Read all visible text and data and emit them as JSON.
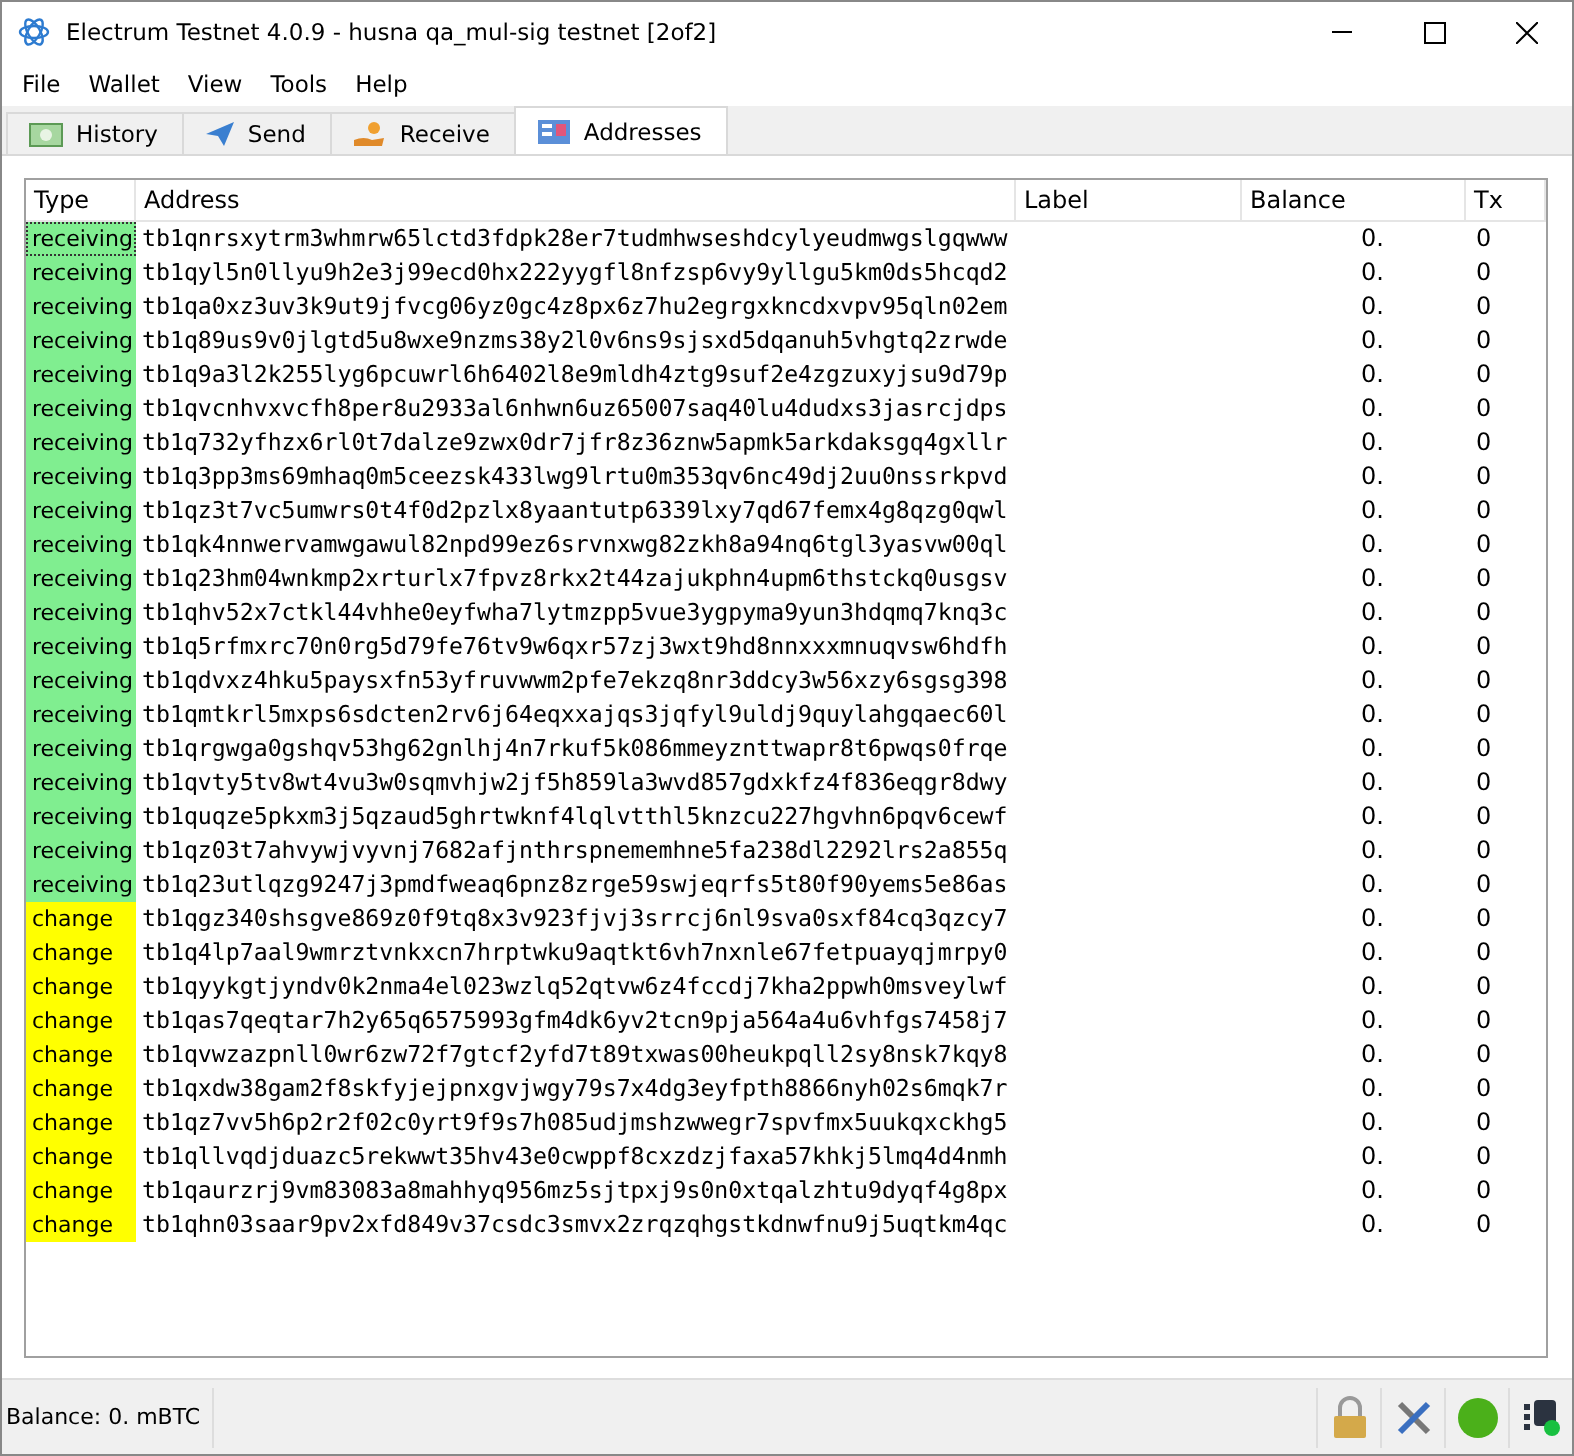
{
  "window": {
    "title": "Electrum Testnet 4.0.9  -  husna qa_mul-sig testnet  [2of2]"
  },
  "menu": [
    "File",
    "Wallet",
    "View",
    "Tools",
    "Help"
  ],
  "tabs": [
    {
      "label": "History",
      "selected": false
    },
    {
      "label": "Send",
      "selected": false
    },
    {
      "label": "Receive",
      "selected": false
    },
    {
      "label": "Addresses",
      "selected": true
    }
  ],
  "table": {
    "columns": [
      "Type",
      "Address",
      "Label",
      "Balance",
      "Tx"
    ],
    "rows": [
      {
        "type": "receiving",
        "kind": "receiving",
        "focused": true,
        "address": "tb1qnrsxytrm3whmrw65lctd3fdpk28er7tudmhwseshdcylyeudmwgslgqwww",
        "balance": "0.",
        "tx": "0"
      },
      {
        "type": "receiving",
        "kind": "receiving",
        "focused": false,
        "address": "tb1qyl5n0llyu9h2e3j99ecd0hx222yygfl8nfzsp6vy9yllgu5km0ds5hcqd2",
        "balance": "0.",
        "tx": "0"
      },
      {
        "type": "receiving",
        "kind": "receiving",
        "focused": false,
        "address": "tb1qa0xz3uv3k9ut9jfvcg06yz0gc4z8px6z7hu2egrgxkncdxvpv95qln02em",
        "balance": "0.",
        "tx": "0"
      },
      {
        "type": "receiving",
        "kind": "receiving",
        "focused": false,
        "address": "tb1q89us9v0jlgtd5u8wxe9nzms38y2l0v6ns9sjsxd5dqanuh5vhgtq2zrwde",
        "balance": "0.",
        "tx": "0"
      },
      {
        "type": "receiving",
        "kind": "receiving",
        "focused": false,
        "address": "tb1q9a3l2k255lyg6pcuwrl6h6402l8e9mldh4ztg9suf2e4zgzuxyjsu9d79p",
        "balance": "0.",
        "tx": "0"
      },
      {
        "type": "receiving",
        "kind": "receiving",
        "focused": false,
        "address": "tb1qvcnhvxvcfh8per8u2933al6nhwn6uz65007saq40lu4dudxs3jasrcjdps",
        "balance": "0.",
        "tx": "0"
      },
      {
        "type": "receiving",
        "kind": "receiving",
        "focused": false,
        "address": "tb1q732yfhzx6rl0t7dalze9zwx0dr7jfr8z36znw5apmk5arkdaksgq4gxllr",
        "balance": "0.",
        "tx": "0"
      },
      {
        "type": "receiving",
        "kind": "receiving",
        "focused": false,
        "address": "tb1q3pp3ms69mhaq0m5ceezsk433lwg9lrtu0m353qv6nc49dj2uu0nssrkpvd",
        "balance": "0.",
        "tx": "0"
      },
      {
        "type": "receiving",
        "kind": "receiving",
        "focused": false,
        "address": "tb1qz3t7vc5umwrs0t4f0d2pzlx8yaantutp6339lxy7qd67femx4g8qzg0qwl",
        "balance": "0.",
        "tx": "0"
      },
      {
        "type": "receiving",
        "kind": "receiving",
        "focused": false,
        "address": "tb1qk4nnwervamwgawul82npd99ez6srvnxwg82zkh8a94nq6tgl3yasvw00ql",
        "balance": "0.",
        "tx": "0"
      },
      {
        "type": "receiving",
        "kind": "receiving",
        "focused": false,
        "address": "tb1q23hm04wnkmp2xrturlx7fpvz8rkx2t44zajukphn4upm6thstckq0usgsv",
        "balance": "0.",
        "tx": "0"
      },
      {
        "type": "receiving",
        "kind": "receiving",
        "focused": false,
        "address": "tb1qhv52x7ctkl44vhhe0eyfwha7lytmzpp5vue3ygpyma9yun3hdqmq7knq3c",
        "balance": "0.",
        "tx": "0"
      },
      {
        "type": "receiving",
        "kind": "receiving",
        "focused": false,
        "address": "tb1q5rfmxrc70n0rg5d79fe76tv9w6qxr57zj3wxt9hd8nnxxxmnuqvsw6hdfh",
        "balance": "0.",
        "tx": "0"
      },
      {
        "type": "receiving",
        "kind": "receiving",
        "focused": false,
        "address": "tb1qdvxz4hku5paysxfn53yfruvwwm2pfe7ekzq8nr3ddcy3w56xzy6sgsg398",
        "balance": "0.",
        "tx": "0"
      },
      {
        "type": "receiving",
        "kind": "receiving",
        "focused": false,
        "address": "tb1qmtkrl5mxps6sdcten2rv6j64eqxxajqs3jqfyl9uldj9quylahgqaec60l",
        "balance": "0.",
        "tx": "0"
      },
      {
        "type": "receiving",
        "kind": "receiving",
        "focused": false,
        "address": "tb1qrgwga0gshqv53hg62gnlhj4n7rkuf5k086mmeyznttwapr8t6pwqs0frqe",
        "balance": "0.",
        "tx": "0"
      },
      {
        "type": "receiving",
        "kind": "receiving",
        "focused": false,
        "address": "tb1qvty5tv8wt4vu3w0sqmvhjw2jf5h859la3wvd857gdxkfz4f836eqgr8dwy",
        "balance": "0.",
        "tx": "0"
      },
      {
        "type": "receiving",
        "kind": "receiving",
        "focused": false,
        "address": "tb1quqze5pkxm3j5qzaud5ghrtwknf4lqlvtthl5knzcu227hgvhn6pqv6cewf",
        "balance": "0.",
        "tx": "0"
      },
      {
        "type": "receiving",
        "kind": "receiving",
        "focused": false,
        "address": "tb1qz03t7ahvywjvyvnj7682afjnthrspnememhne5fa238dl2292lrs2a855q",
        "balance": "0.",
        "tx": "0"
      },
      {
        "type": "receiving",
        "kind": "receiving",
        "focused": false,
        "address": "tb1q23utlqzg9247j3pmdfweaq6pnz8zrge59swjeqrfs5t80f90yems5e86as",
        "balance": "0.",
        "tx": "0"
      },
      {
        "type": "change",
        "kind": "change",
        "focused": false,
        "address": "tb1qgz340shsgve869z0f9tq8x3v923fjvj3srrcj6nl9sva0sxf84cq3qzcy7",
        "balance": "0.",
        "tx": "0"
      },
      {
        "type": "change",
        "kind": "change",
        "focused": false,
        "address": "tb1q4lp7aal9wmrztvnkxcn7hrptwku9aqtkt6vh7nxnle67fetpuayqjmrpy0",
        "balance": "0.",
        "tx": "0"
      },
      {
        "type": "change",
        "kind": "change",
        "focused": false,
        "address": "tb1qyykgtjyndv0k2nma4el023wzlq52qtvw6z4fccdj7kha2ppwh0msveylwf",
        "balance": "0.",
        "tx": "0"
      },
      {
        "type": "change",
        "kind": "change",
        "focused": false,
        "address": "tb1qas7qeqtar7h2y65q6575993gfm4dk6yv2tcn9pja564a4u6vhfgs7458j7",
        "balance": "0.",
        "tx": "0"
      },
      {
        "type": "change",
        "kind": "change",
        "focused": false,
        "address": "tb1qvwzazpnll0wr6zw72f7gtcf2yfd7t89txwas00heukpqll2sy8nsk7kqy8",
        "balance": "0.",
        "tx": "0"
      },
      {
        "type": "change",
        "kind": "change",
        "focused": false,
        "address": "tb1qxdw38gam2f8skfyjejpnxgvjwgy79s7x4dg3eyfpth8866nyh02s6mqk7r",
        "balance": "0.",
        "tx": "0"
      },
      {
        "type": "change",
        "kind": "change",
        "focused": false,
        "address": "tb1qz7vv5h6p2r2f02c0yrt9f9s7h085udjmshzwwegr7spvfmx5uukqxckhg5",
        "balance": "0.",
        "tx": "0"
      },
      {
        "type": "change",
        "kind": "change",
        "focused": false,
        "address": "tb1qllvqdjduazc5rekwwt35hv43e0cwppf8cxzdzjfaxa57khkj5lmq4d4nmh",
        "balance": "0.",
        "tx": "0"
      },
      {
        "type": "change",
        "kind": "change",
        "focused": false,
        "address": "tb1qaurzrj9vm83083a8mahhyq956mz5sjtpxj9s0n0xtqalzhtu9dyqf4g8px",
        "balance": "0.",
        "tx": "0"
      },
      {
        "type": "change",
        "kind": "change",
        "focused": false,
        "address": "tb1qhn03saar9pv2xfd849v37csdc3smvx2zrqzqhgstkdnwfnu9j5uqtkm4qc",
        "balance": "0.",
        "tx": "0"
      }
    ]
  },
  "status_bar": {
    "balance": "Balance: 0. mBTC"
  }
}
